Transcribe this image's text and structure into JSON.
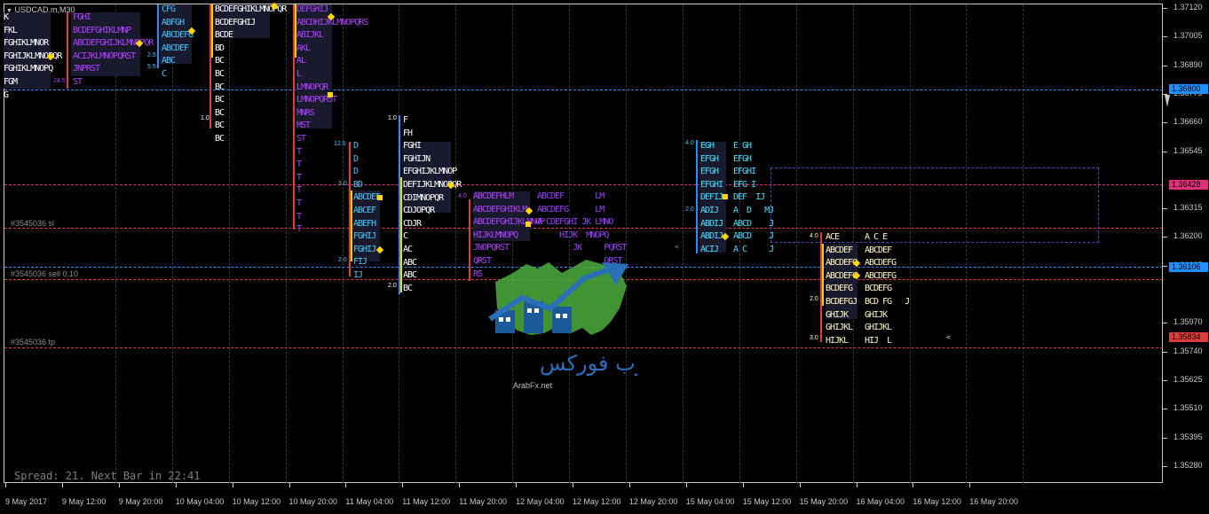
{
  "symbol_label": "USDCAD,m,M30",
  "colors": {
    "background": "#000000",
    "axis": "#c8c8c8",
    "blue_line": "#1e90ff",
    "pink_line": "#e0307a",
    "red_line": "#e03c3c"
  },
  "price_labels": [
    "1.37120",
    "1.37005",
    "1.36890",
    "1.36775",
    "1.36660",
    "1.36545",
    "1.36315",
    "1.36200",
    "1.36085",
    "1.35970",
    "1.35740",
    "1.35625",
    "1.35510",
    "1.35395",
    "1.35280"
  ],
  "price_tags": {
    "line1": "1.36800",
    "line2": "1.36428",
    "line3": "1.36106",
    "line4": "1.35834"
  },
  "time_labels": [
    "9 May 2017",
    "9 May 12:00",
    "9 May 20:00",
    "10 May 04:00",
    "10 May 12:00",
    "10 May 20:00",
    "11 May 04:00",
    "11 May 12:00",
    "11 May 20:00",
    "12 May 04:00",
    "12 May 12:00",
    "12 May 20:00",
    "15 May 04:00",
    "15 May 12:00",
    "15 May 20:00",
    "16 May 04:00",
    "16 May 12:00",
    "16 May 20:00"
  ],
  "order_lines": {
    "sl": "#3545036 sl",
    "sell": "#3545036 sell 0.10",
    "tp": "#3545036 tp"
  },
  "status_line": "Spread: 21. Next Bar in 22:41",
  "watermark": {
    "arabic": "عرب فوركس",
    "url": "ArabFx.net"
  },
  "profiles": {
    "p1": [
      "K",
      "FKL",
      "FGHIKLMNOR",
      "FGHIJKLMNOPQR",
      "FGHIKLMNOPQ",
      "FGM",
      "G"
    ],
    "p2": [
      "FGHI",
      "BCDEFGHIKLMNP",
      "ABCDEFGHIJKLMNOPQR",
      "ACIJKLMNOPQRST",
      "JNPRST",
      "ST"
    ],
    "p3": [
      "CFG",
      "ABFGH",
      "ABCDEFG",
      "ABCDEF",
      "ABC",
      "C"
    ],
    "p4": [
      "BCDEFGHIKLMNOPQR",
      "BCDEFGHIJ",
      "BCDE",
      "BD",
      "BC",
      "BC",
      "BC",
      "BC",
      "BC",
      "BC",
      "BC"
    ],
    "p5": [
      "DEFGHIJ",
      "ABCDHIJKLMNOPQRS",
      "ABIJKL",
      "AKL",
      "AL",
      "L",
      "LMNOPQR",
      "LMNOPQRST",
      "MNRS",
      "MST",
      "ST",
      "T",
      "T",
      "T",
      "T",
      "T",
      "T",
      "T"
    ],
    "p6": [
      "D",
      "D",
      "D",
      "BD",
      "ABCDEF",
      "ABCEF",
      "ABEFH",
      "FGHIJ",
      "FGHIJ",
      "FIJ",
      "IJ"
    ],
    "p7": [
      "F",
      "FH",
      "FGHI",
      "FGHIJN",
      "EFGHIJKLMNOP",
      "DEFIJKLMNOPQR",
      "CDIMNOPQR",
      "CDJOPQR",
      "CDJR",
      "C",
      "AC",
      "ABC",
      "ABC",
      "BC"
    ],
    "p8": [
      "ABCDEFHLM",
      "ABCDEFGHIKLM",
      "ABCDEFGHIJKLMNOP",
      "HIJKLMNOPQ",
      "JNOPQRST",
      "QRST",
      "RS"
    ],
    "p8b": [
      "ABCDEF       LM",
      "ABCDEFG      LM",
      "A CDEFGHI JK LMNO",
      "     HIJK  MNOPQ",
      "        JK     PQRST",
      "               QRST",
      "                RS"
    ],
    "p9": [
      "EGH",
      "EFGH",
      "EFGH",
      "EFGHI",
      "DEFIJ",
      "ADIJ",
      "ABDIJ",
      "ABDIJ",
      "ACIJ"
    ],
    "p9b": [
      "E GH",
      "EFGH",
      "EFGHI",
      "EFG I",
      "DEF  IJ",
      "A  D   MJ",
      "ABCD    J",
      "ABCD    J",
      "A C     J"
    ],
    "p10": [
      "ACE",
      "ABCDEF",
      "ABCDEFG",
      "ABCDEFG",
      "BCDEFG",
      "BCDEFGJ",
      "GHIJK",
      "GHIJKL",
      "HIJKL"
    ],
    "p10b": [
      "A C E",
      "ABCDEF",
      "ABCDEFG",
      "ABCDEFG",
      "BCDEFG",
      "BCD FG   J",
      "GHIJK",
      "GHIJKL",
      "HIJ  L"
    ]
  },
  "value_stamps": {
    "v1": "12.5",
    "v2": "4.0",
    "v3": "3.0",
    "v4": "2.0",
    "v5": "1.0",
    "v6": "24.5",
    "v7": "5.5",
    "v8": "2.5"
  }
}
